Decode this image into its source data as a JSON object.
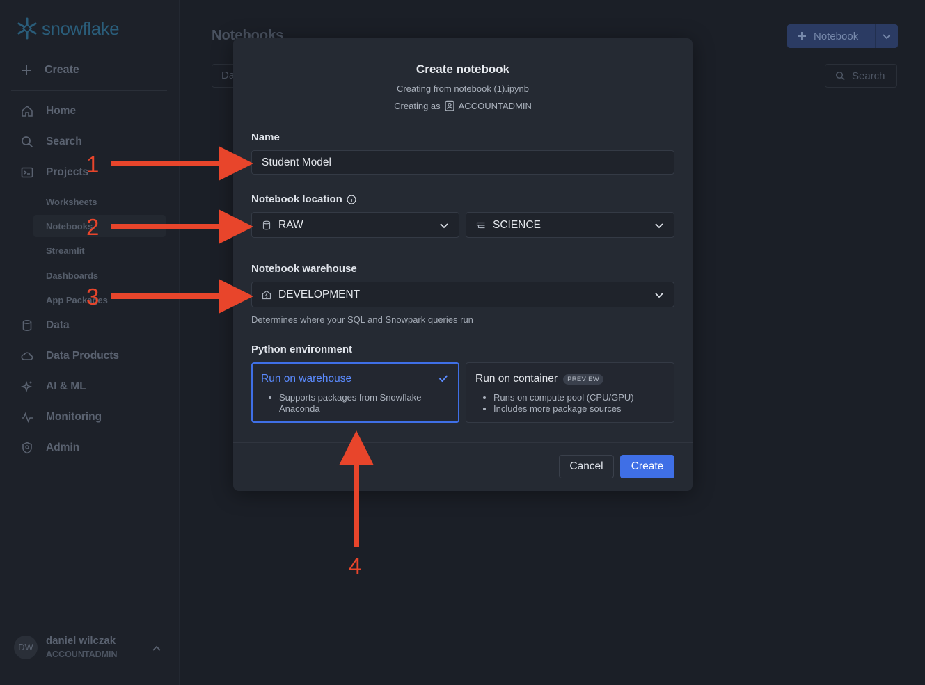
{
  "sidebar": {
    "logo_text": "snowflake",
    "create_label": "Create",
    "nav": {
      "home": "Home",
      "search": "Search",
      "projects": "Projects",
      "data": "Data",
      "data_products": "Data Products",
      "ai_ml": "AI & ML",
      "monitoring": "Monitoring",
      "admin": "Admin"
    },
    "sub": {
      "worksheets": "Worksheets",
      "notebooks": "Notebooks",
      "streamlit": "Streamlit",
      "dashboards": "Dashboards",
      "app_packages": "App Packages"
    },
    "user": {
      "initials": "DW",
      "name": "daniel wilczak",
      "role": "ACCOUNTADMIN"
    }
  },
  "main": {
    "title": "Notebooks",
    "new_notebook_label": "Notebook",
    "search_label": "Search",
    "filter_label": "Da"
  },
  "modal": {
    "title": "Create notebook",
    "subtitle_from": "Creating from notebook (1).ipynb",
    "creating_as_prefix": "Creating as",
    "creating_as_role": "ACCOUNTADMIN",
    "name_label": "Name",
    "name_value": "Student Model",
    "location_label": "Notebook location",
    "database_value": "RAW",
    "schema_value": "SCIENCE",
    "warehouse_label": "Notebook warehouse",
    "warehouse_value": "DEVELOPMENT",
    "warehouse_hint": "Determines where your SQL and Snowpark queries run",
    "python_env_label": "Python environment",
    "option_warehouse": {
      "title": "Run on warehouse",
      "bullets": [
        "Supports packages from Snowflake",
        "Anaconda"
      ]
    },
    "option_container": {
      "title": "Run on container",
      "badge": "PREVIEW",
      "bullets": [
        "Runs on compute pool (CPU/GPU)",
        "Includes more package sources"
      ]
    },
    "cancel_label": "Cancel",
    "create_label": "Create"
  },
  "annotations": [
    "1",
    "2",
    "3",
    "4"
  ],
  "colors": {
    "accent": "#3f6fe6",
    "annotation": "#e8452b",
    "background": "#1b1f27",
    "modal": "#252a33"
  }
}
